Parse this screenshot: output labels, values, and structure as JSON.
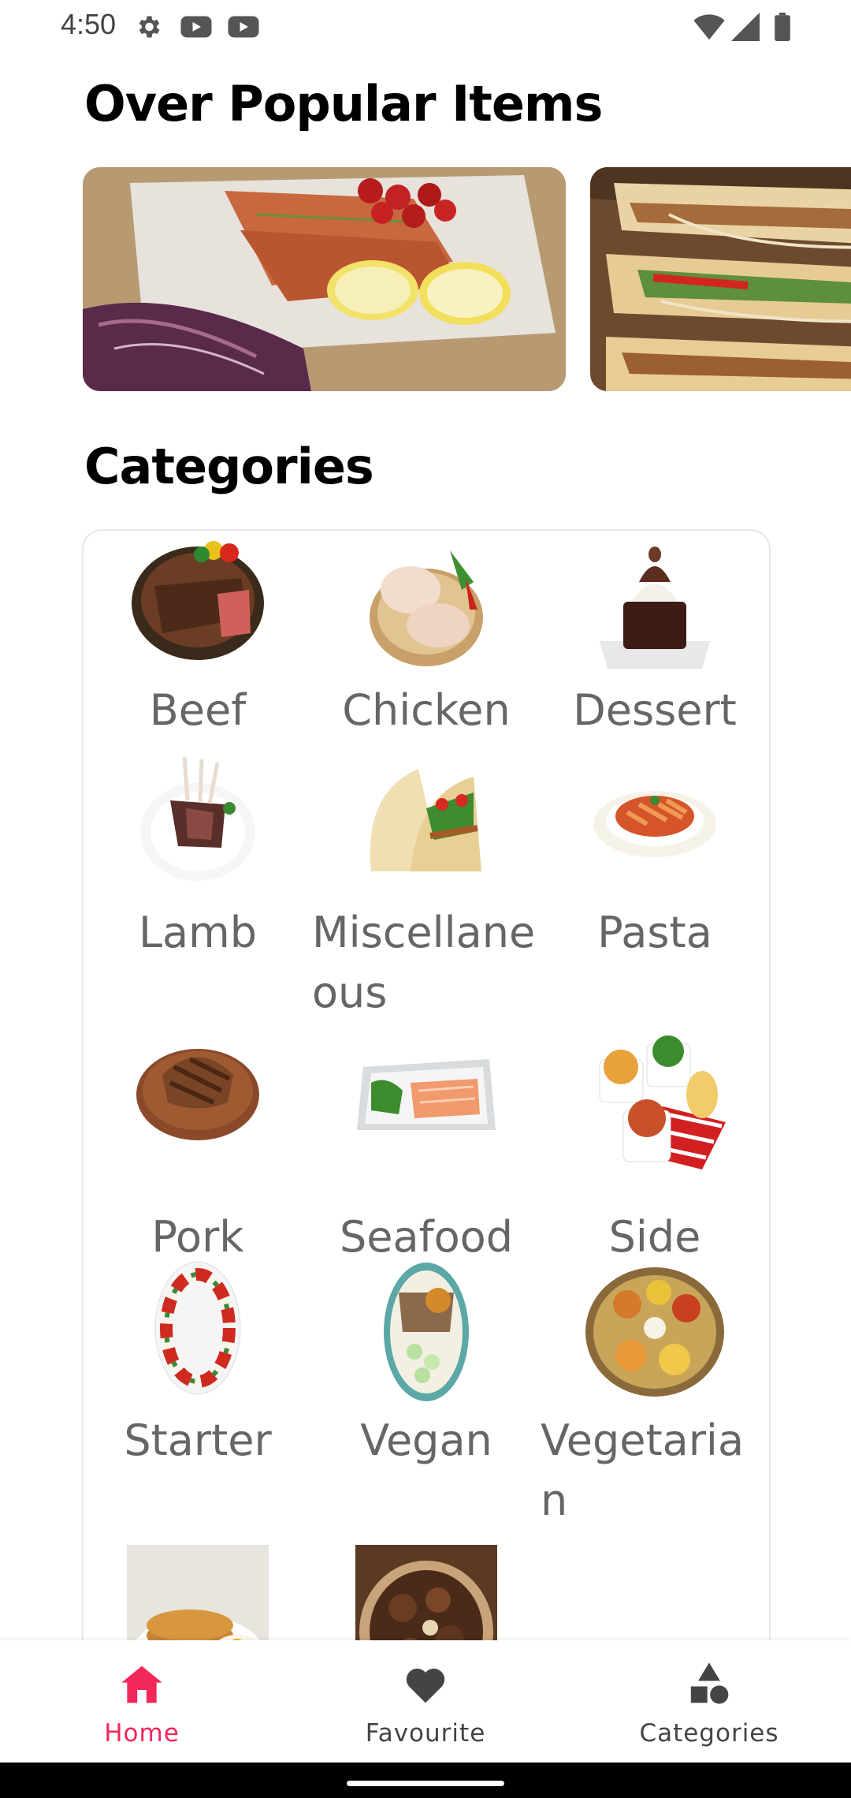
{
  "status_bar": {
    "time": "4:50",
    "icons_left": [
      "gear-icon",
      "youtube-icon",
      "youtube-icon"
    ],
    "icons_right": [
      "wifi-icon",
      "signal-icon",
      "battery-icon"
    ]
  },
  "popular": {
    "title": "Over Popular Items",
    "items": [
      {
        "image": "salmon-fillet-with-lemon-and-tomatoes"
      },
      {
        "image": "chicken-tacos"
      }
    ]
  },
  "categories": {
    "title": "Categories",
    "items": [
      {
        "label": "Beef"
      },
      {
        "label": "Chicken"
      },
      {
        "label": "Dessert"
      },
      {
        "label": "Lamb"
      },
      {
        "label": "Miscellaneous"
      },
      {
        "label": "Pasta"
      },
      {
        "label": "Pork"
      },
      {
        "label": "Seafood"
      },
      {
        "label": "Side"
      },
      {
        "label": "Starter"
      },
      {
        "label": "Vegan"
      },
      {
        "label": "Vegetarian"
      },
      {
        "label": ""
      },
      {
        "label": ""
      }
    ]
  },
  "bottom_nav": {
    "items": [
      {
        "label": "Home",
        "icon": "home-icon",
        "active": true
      },
      {
        "label": "Favourite",
        "icon": "heart-icon",
        "active": false
      },
      {
        "label": "Categories",
        "icon": "shapes-icon",
        "active": false
      }
    ],
    "active_color": "#f2275a",
    "inactive_color": "#444444"
  }
}
